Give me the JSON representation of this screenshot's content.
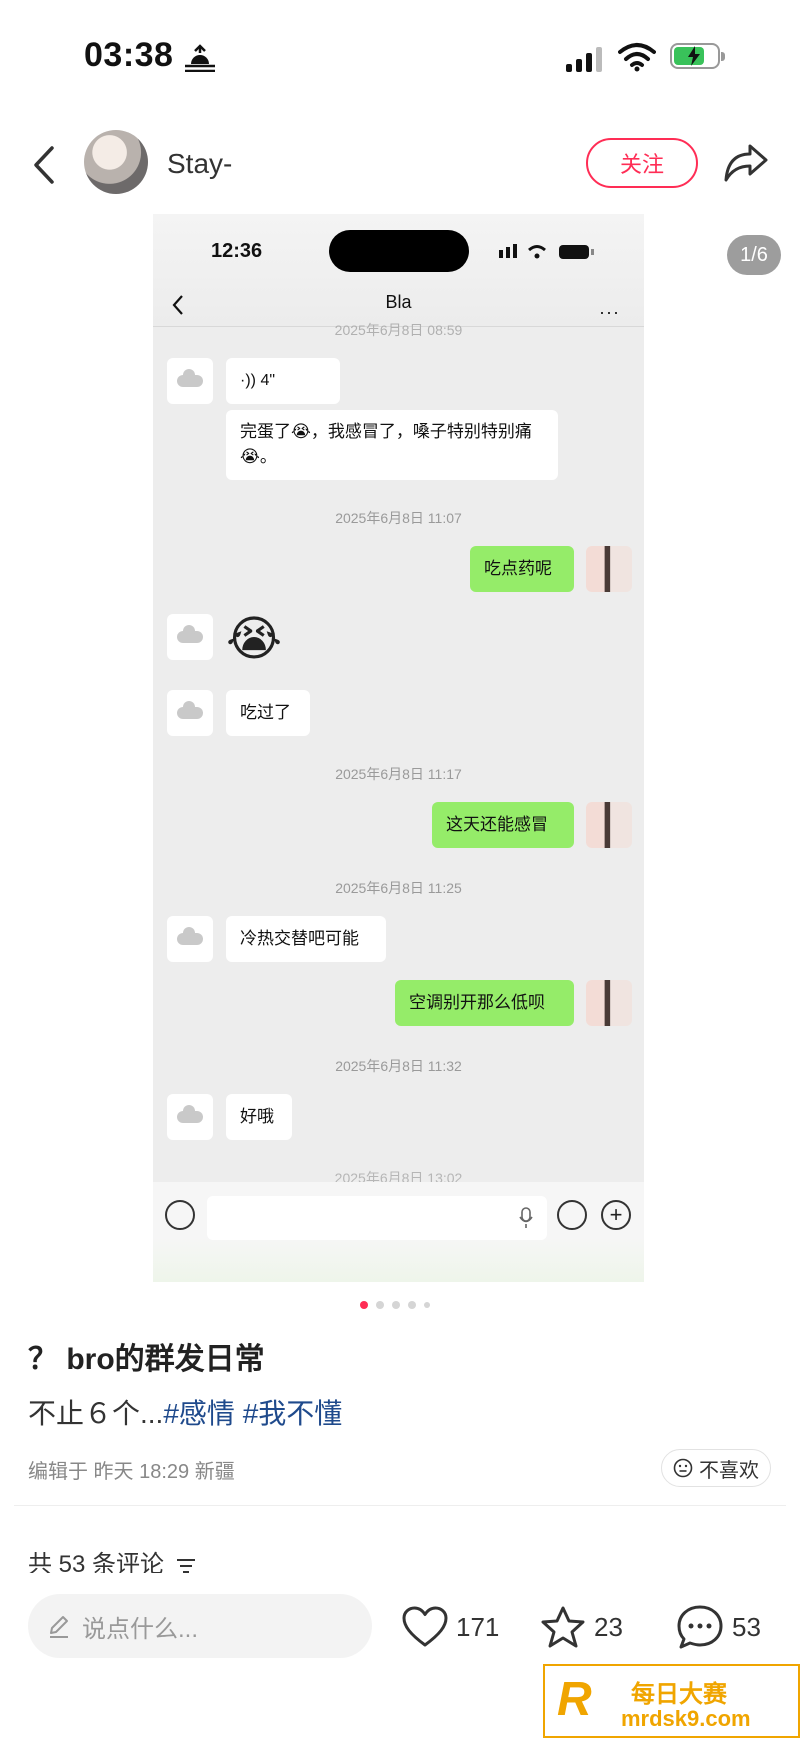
{
  "status_bar": {
    "time": "03:38"
  },
  "header": {
    "username": "Stay-",
    "follow_label": "关注"
  },
  "image_badge": "1/6",
  "screenshot": {
    "time": "12:36",
    "chat_title": "Bla",
    "more": "···",
    "timestamps": [
      "2025年6月8日 08:59",
      "2025年6月8日 11:07",
      "2025年6月8日 11:17",
      "2025年6月8日 11:25",
      "2025年6月8日 11:32",
      "2025年6月8日 13:02"
    ],
    "voice_length": "4\"",
    "messages": [
      "完蛋了😭，我感冒了，嗓子特别特别痛😭。",
      "吃点药呢",
      "😭",
      "吃过了",
      "这天还能感冒",
      "冷热交替吧可能",
      "空调别开那么低呗",
      "好哦"
    ]
  },
  "carousel": {
    "count": 5,
    "active_index": 0
  },
  "post": {
    "title": "？ bro的群发日常",
    "body_text": "不止６个...",
    "tags": [
      "#感情",
      "#我不懂"
    ],
    "meta": "编辑于 昨天 18:29 新疆",
    "dislike_label": "不喜欢",
    "comments_label": "共 53 条评论"
  },
  "bottom_bar": {
    "input_placeholder": "说点什么...",
    "likes": "171",
    "favorites": "23",
    "comments": "53"
  },
  "watermark": {
    "title": "每日大赛",
    "url": "mrdsk9.com"
  },
  "colors": {
    "accent": "#ff2d55",
    "wechat_green": "#95ec69",
    "tag_blue": "#1f4a8c"
  }
}
